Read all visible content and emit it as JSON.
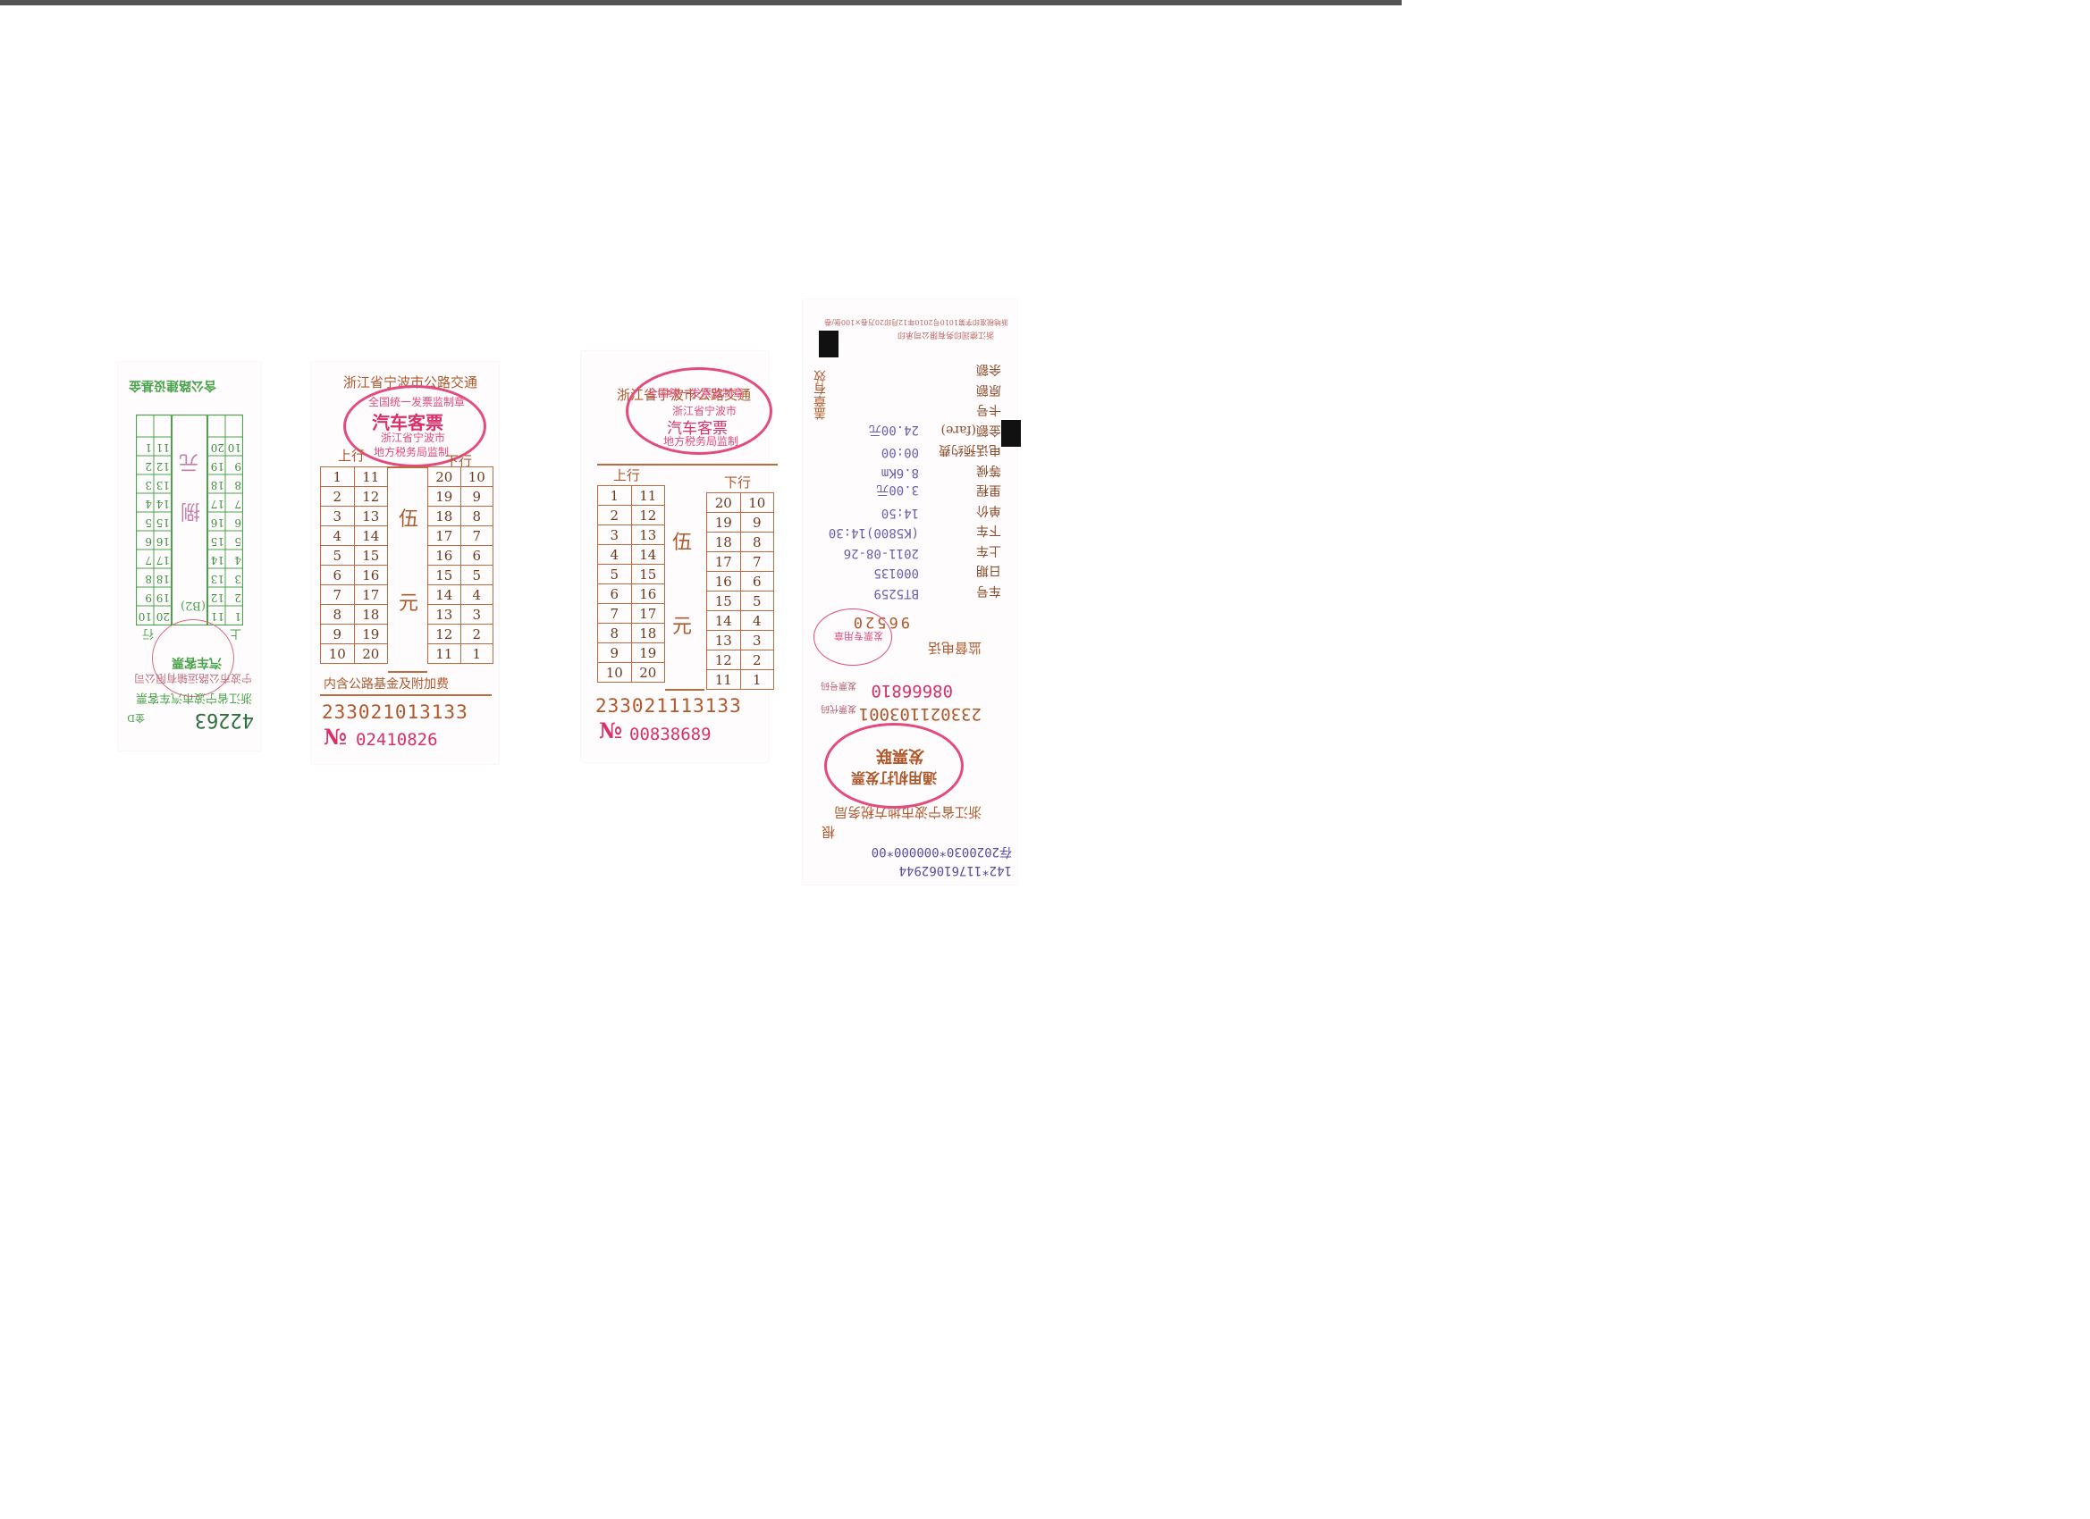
{
  "ticket1": {
    "header": "含公路建设基金",
    "label_shang": "上",
    "label_xia": "下",
    "label_xing": "行",
    "center_char1": "元",
    "center_char2": "捌",
    "left_col_a": [
      "1",
      "2",
      "3",
      "4",
      "5",
      "6",
      "7",
      "8",
      "9",
      "10"
    ],
    "left_col_b": [
      "11",
      "12",
      "13",
      "14",
      "15",
      "16",
      "17",
      "18",
      "19",
      "20"
    ],
    "right_col_a": [
      "20",
      "19",
      "18",
      "17",
      "16",
      "15",
      "14",
      "13",
      "12",
      "11"
    ],
    "right_col_b": [
      "10",
      "9",
      "8",
      "7",
      "6",
      "5",
      "4",
      "3",
      "2",
      "1"
    ],
    "stamp_code": "(B2)",
    "title": "汽车客票",
    "company": "宁波市公路运输有限公司",
    "footer": "浙江省宁波市汽车客票",
    "prefix": "金D",
    "serial": "42263"
  },
  "ticket2": {
    "header": "浙江省宁波市公路交通",
    "title": "汽车客票",
    "stamp_top": "全国统一发票监制章",
    "stamp_mid": "浙江省宁波市",
    "stamp_bottom": "地方税务局监制",
    "up": "上行",
    "down": "下行",
    "amount_1": "伍",
    "amount_2": "元",
    "left_a": [
      "1",
      "2",
      "3",
      "4",
      "5",
      "6",
      "7",
      "8",
      "9",
      "10"
    ],
    "left_b": [
      "11",
      "12",
      "13",
      "14",
      "15",
      "16",
      "17",
      "18",
      "19",
      "20"
    ],
    "right_a": [
      "20",
      "19",
      "18",
      "17",
      "16",
      "15",
      "14",
      "13",
      "12",
      "11"
    ],
    "right_b": [
      "10",
      "9",
      "8",
      "7",
      "6",
      "5",
      "4",
      "3",
      "2",
      "1"
    ],
    "footer": "内含公路基金及附加费",
    "code": "233021013133",
    "no_mark": "№",
    "number": "02410826"
  },
  "ticket3": {
    "header": "浙江省宁波市公路交通",
    "title": "汽车客票",
    "stamp_top": "全国统一发票监制章",
    "stamp_mid": "浙江省宁波市",
    "stamp_bottom": "地方税务局监制",
    "up": "上行",
    "down": "下行",
    "amount_1": "伍",
    "amount_2": "元",
    "left_a": [
      "1",
      "2",
      "3",
      "4",
      "5",
      "6",
      "7",
      "8",
      "9",
      "10"
    ],
    "left_b": [
      "11",
      "12",
      "13",
      "14",
      "15",
      "16",
      "17",
      "18",
      "19",
      "20"
    ],
    "right_a": [
      "20",
      "19",
      "18",
      "17",
      "16",
      "15",
      "14",
      "13",
      "12",
      "11"
    ],
    "right_b": [
      "10",
      "9",
      "8",
      "7",
      "6",
      "5",
      "4",
      "3",
      "2",
      "1"
    ],
    "code": "233021113133",
    "no_mark": "№",
    "number": "00838689"
  },
  "ticket4": {
    "side_text": "盖章有效",
    "printer_line1": "浙江德润印务有限公司承印",
    "printer_line2": "浙地税准印字第1010号2010年12月印20万卷×100张/卷",
    "rows": [
      {
        "label": "余额",
        "value": ""
      },
      {
        "label": "原额",
        "value": ""
      },
      {
        "label": "卡号",
        "value": ""
      },
      {
        "label": "金额(fare)",
        "value": "24.00元"
      },
      {
        "label": "电话预约费",
        "value": "00:00"
      },
      {
        "label": "等候",
        "value": "8.6Km"
      },
      {
        "label": "里程",
        "value": "3.00元"
      },
      {
        "label": "单价",
        "value": "14:50"
      },
      {
        "label": "下车",
        "value": "(K5800)14:30"
      },
      {
        "label": "上车",
        "value": "2011-08-26"
      },
      {
        "label": "日期",
        "value": "000135"
      },
      {
        "label": "车号",
        "value": "BT5259"
      }
    ],
    "stamp_small": "发票专用章",
    "complaint_label": "监督电话",
    "complaint_number": "96520",
    "invoice_no_label": "发票号码",
    "invoice_no": "08666810",
    "invoice_code_label": "发票代码",
    "invoice_code": "233021103001",
    "stamp_title": "通用机打发票",
    "stamp_sub": "发票联",
    "authority": "浙江省宁波市地方税务局",
    "tail_mark": "根",
    "machine_line1": "存2020030*000000*00",
    "machine_line2": "142*11761062944"
  },
  "colors": {
    "green": "#4aa34a",
    "brown": "#b0582c",
    "red": "#d8306a",
    "purple": "#7a6bb8"
  }
}
